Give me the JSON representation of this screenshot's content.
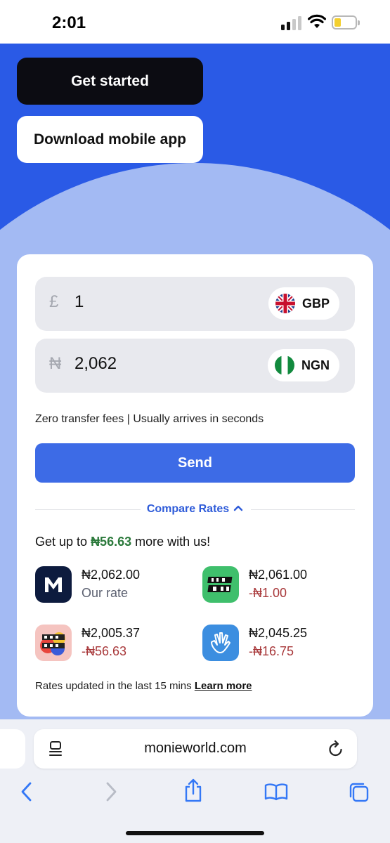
{
  "status_bar": {
    "time": "2:01"
  },
  "hero": {
    "get_started_label": "Get started",
    "download_label": "Download mobile app"
  },
  "converter": {
    "send": {
      "symbol": "£",
      "amount": "1",
      "currency": "GBP"
    },
    "receive": {
      "symbol": "₦",
      "amount": "2,062",
      "currency": "NGN"
    },
    "info": "Zero transfer fees | Usually arrives in seconds",
    "send_button": "Send",
    "compare_label": "Compare Rates",
    "get_up_prefix": "Get up to ",
    "get_up_amount": "₦56.63",
    "get_up_suffix": " more with us!",
    "providers": [
      {
        "logo": "monieworld-logo",
        "rate": "₦2,062.00",
        "sub": "Our rate"
      },
      {
        "logo": "lemfi-logo",
        "rate": "₦2,061.00",
        "sub": "-₦1.00"
      },
      {
        "logo": "sendapp-logo",
        "rate": "₦2,005.37",
        "sub": "-₦56.63"
      },
      {
        "logo": "hand-wave-logo",
        "rate": "₦2,045.25",
        "sub": "-₦16.75"
      }
    ],
    "rates_updated": "Rates updated in the last 15 mins ",
    "learn_more": "Learn more"
  },
  "browser": {
    "url": "monieworld.com"
  },
  "colors": {
    "brand_blue": "#2a5ae6",
    "send_button": "#3d6be6",
    "positive_green": "#2c7a3c",
    "negative_red": "#a8383a"
  }
}
